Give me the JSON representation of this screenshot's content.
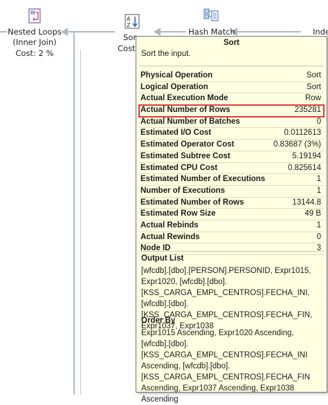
{
  "plan": {
    "nested_loops": {
      "title": "Nested Loops",
      "subtitle": "(Inner Join)",
      "cost": "Cost: 2 %",
      "icon": "nested-loops-icon"
    },
    "sort": {
      "title_partial": "Sor",
      "cost_partial": "Cost:",
      "icon": "sort-icon"
    },
    "hash_match": {
      "title": "Hash Match",
      "icon": "hash-match-icon"
    },
    "index": {
      "title_partial": "Inde"
    }
  },
  "tooltip": {
    "title": "Sort",
    "description": "Sort the input.",
    "properties": [
      {
        "name": "Physical Operation",
        "value": "Sort"
      },
      {
        "name": "Logical Operation",
        "value": "Sort"
      },
      {
        "name": "Actual Execution Mode",
        "value": "Row"
      },
      {
        "name": "Actual Number of Rows",
        "value": "235281",
        "highlight": true
      },
      {
        "name": "Actual Number of Batches",
        "value": "0"
      },
      {
        "name": "Estimated I/O Cost",
        "value": "0.0112613"
      },
      {
        "name": "Estimated Operator Cost",
        "value": "0.83687 (3%)"
      },
      {
        "name": "Estimated Subtree Cost",
        "value": "5.19194"
      },
      {
        "name": "Estimated CPU Cost",
        "value": "0.825614"
      },
      {
        "name": "Estimated Number of Executions",
        "value": "1"
      },
      {
        "name": "Number of Executions",
        "value": "1"
      },
      {
        "name": "Estimated Number of Rows",
        "value": "13144.8"
      },
      {
        "name": "Estimated Row Size",
        "value": "49 B"
      },
      {
        "name": "Actual Rebinds",
        "value": "1"
      },
      {
        "name": "Actual Rewinds",
        "value": "0"
      },
      {
        "name": "Node ID",
        "value": "3"
      }
    ],
    "output_list_title": "Output List",
    "output_list": "[wfcdb].[dbo].[PERSON].PERSONID, Expr1015, Expr1020, [wfcdb].[dbo].[KSS_CARGA_EMPL_CENTROS].FECHA_INI, [wfcdb].[dbo].[KSS_CARGA_EMPL_CENTROS].FECHA_FIN, Expr1037, Expr1038",
    "order_by_title": "Order By",
    "order_by": "Expr1015 Ascending, Expr1020 Ascending, [wfcdb].[dbo].[KSS_CARGA_EMPL_CENTROS].FECHA_INI Ascending, [wfcdb].[dbo].[KSS_CARGA_EMPL_CENTROS].FECHA_FIN Ascending, Expr1037 Ascending, Expr1038 Ascending"
  }
}
